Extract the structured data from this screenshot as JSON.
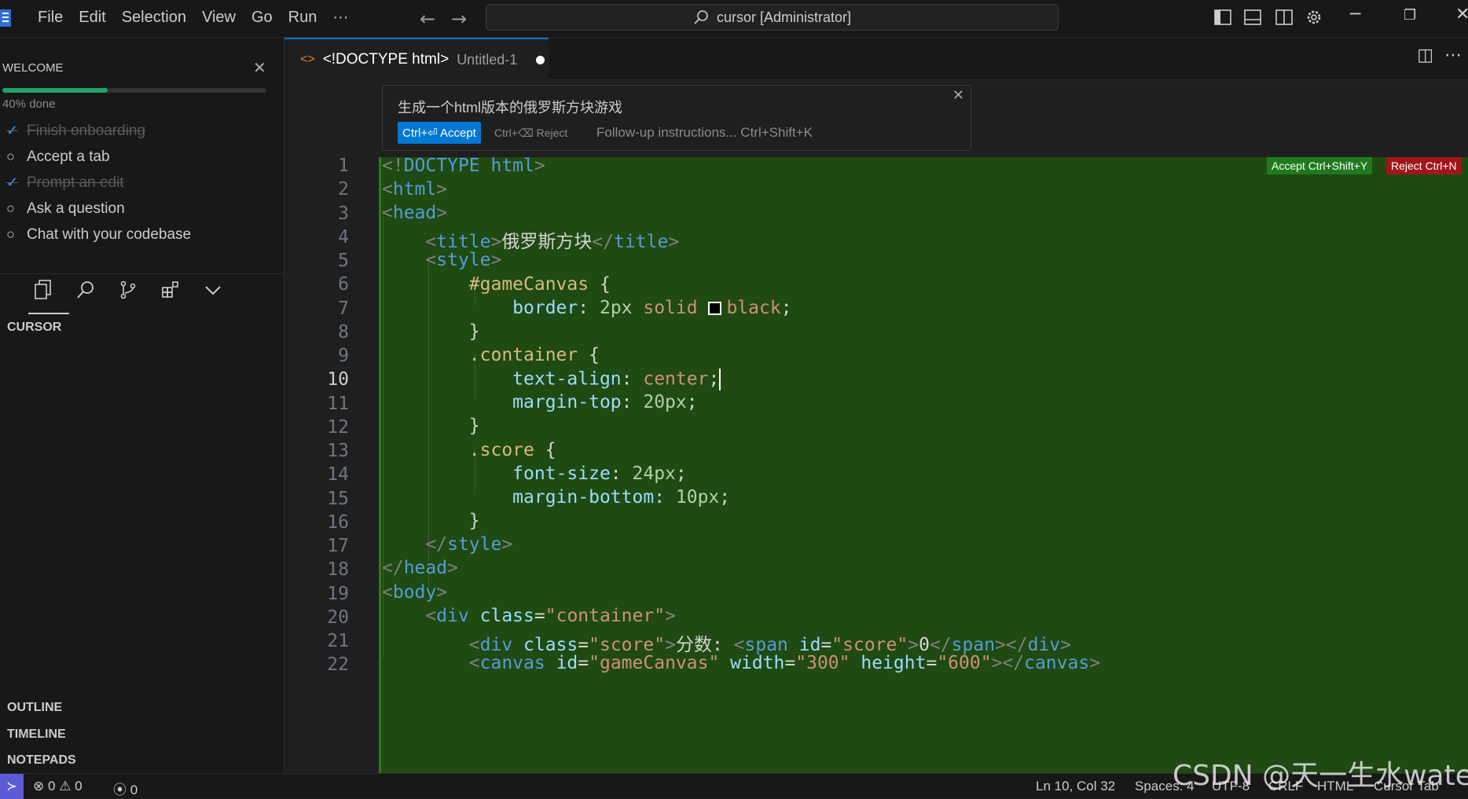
{
  "titlebar": {
    "menu": [
      "File",
      "Edit",
      "Selection",
      "View",
      "Go",
      "Run",
      "···"
    ],
    "search_text": "cursor [Administrator]"
  },
  "sidebar": {
    "welcome_title": "WELCOME",
    "progress": {
      "percent": 40,
      "label": "40% done"
    },
    "checklist": [
      {
        "label": "Finish onboarding",
        "done": true
      },
      {
        "label": "Accept a tab",
        "done": false
      },
      {
        "label": "Prompt an edit",
        "done": true
      },
      {
        "label": "Ask a question",
        "done": false
      },
      {
        "label": "Chat with your codebase",
        "done": false
      }
    ],
    "cursor_section": "CURSOR",
    "outline": "OUTLINE",
    "timeline": "TIMELINE",
    "notepads": "NOTEPADS"
  },
  "tab": {
    "name": "<!DOCTYPE html>",
    "sub": "Untitled-1"
  },
  "prompt": {
    "text": "生成一个html版本的俄罗斯方块游戏",
    "accept_label": "Ctrl+⏎ Accept",
    "reject_label": "Ctrl+⌫ Reject",
    "followup": "Follow-up instructions... Ctrl+Shift+K"
  },
  "diff": {
    "accept_all": "Accept Ctrl+Shift+Y",
    "reject_all": "Reject Ctrl+N"
  },
  "editor": {
    "active_line": 10,
    "line_numbers": [
      "1",
      "2",
      "3",
      "4",
      "5",
      "6",
      "7",
      "8",
      "9",
      "10",
      "11",
      "12",
      "13",
      "14",
      "15",
      "16",
      "17",
      "18",
      "19",
      "20",
      "21",
      "22"
    ]
  },
  "code": {
    "l1a": "<!",
    "l1b": "DOCTYPE html",
    "l1c": ">",
    "l2": "html",
    "l3": "head",
    "l4_title": "title",
    "l4_text": "俄罗斯方块",
    "l5": "style",
    "l6_sel": "#gameCanvas",
    "l6_brace": " {",
    "l7_prop": "border",
    "l7_num": "2px",
    "l7_val": " solid ",
    "l7_color": "black",
    "l8": "}",
    "l9_sel": ".container",
    "l9_brace": " {",
    "l10_prop": "text-align",
    "l10_val": " center",
    "l11_prop": "margin-top",
    "l11_num": " 20px",
    "l12": "}",
    "l13_sel": ".score",
    "l13_brace": " {",
    "l14_prop": "font-size",
    "l14_num": " 24px",
    "l15_prop": "margin-bottom",
    "l15_num": " 10px",
    "l16": "}",
    "l17": "style",
    "l18": "head",
    "l19": "body",
    "l20_tag": "div",
    "l20_attr": " class",
    "l20_val": "\"container\"",
    "l21_tag": "div",
    "l21_attr": " class",
    "l21_val": "\"score\"",
    "l21_text": "分数: ",
    "l21_span": "span",
    "l21_id": " id",
    "l21_idval": "\"score\"",
    "l21_zero": "0",
    "l21_endspan": "span",
    "l21_enddiv": "div",
    "l22_tag": "canvas",
    "l22_id": " id",
    "l22_idval": "\"gameCanvas\"",
    "l22_w": " width",
    "l22_wval": "\"300\"",
    "l22_h": " height",
    "l22_hval": "\"600\"",
    "l22_end": "canvas"
  },
  "statusbar": {
    "errors": "0",
    "warnings": "0",
    "ports": "0",
    "position": "Ln 10, Col 32",
    "spaces": "Spaces: 4",
    "encoding": "UTF-8",
    "eol": "CRLF",
    "language": "HTML",
    "cursor_tab": "Cursor Tab"
  },
  "watermark": "CSDN @天一生水water",
  "colors": {
    "accent": "#0078d4",
    "diff_bg": "#1f4a12",
    "progress": "#21a366",
    "reject": "#a1151b"
  }
}
